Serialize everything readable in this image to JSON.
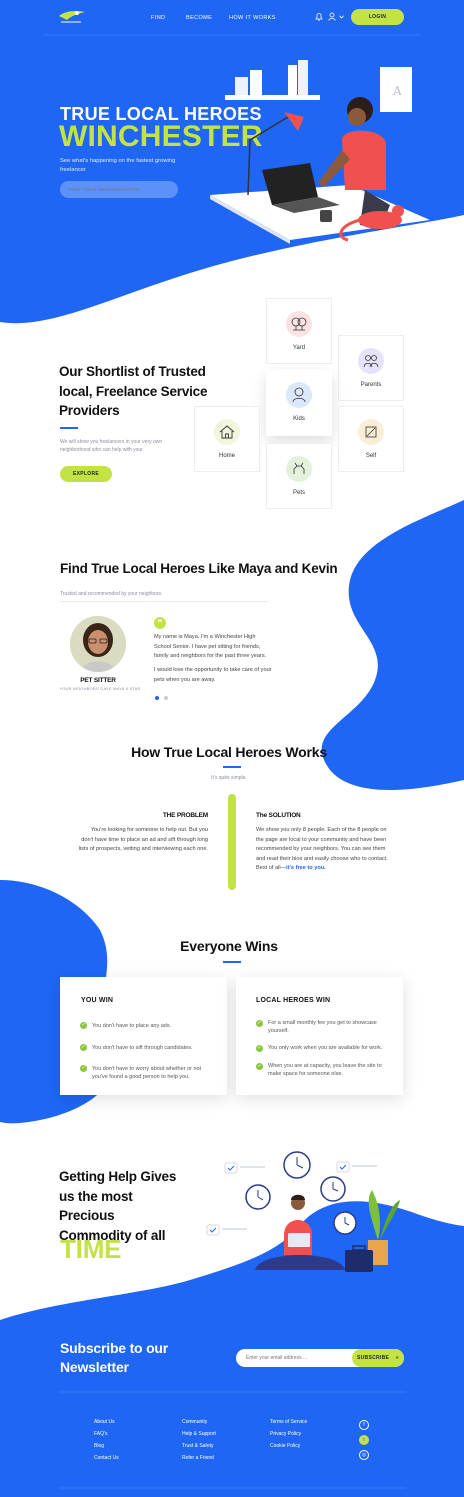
{
  "header": {
    "nav": [
      "FIND",
      "BECOME",
      "HOW IT WORKS"
    ],
    "login_label": "LOGIN",
    "icons": [
      "bell-icon",
      "user-icon",
      "chevron-down-icon"
    ]
  },
  "hero": {
    "title_line1": "TRUE LOCAL HEROES",
    "title_line2": "WINCHESTER",
    "subtitle": "See what's happening on the fastest growing freelancer",
    "search_placeholder": "FIND YOUR NEIGHBORHOOD"
  },
  "shortlist": {
    "heading": "Our Shortlist of Trusted local, Freelance Service Providers",
    "description": "We will show you freelancers in your very own neighborhood who can help with your",
    "button_label": "EXPLORE",
    "categories": [
      {
        "label": "Yard",
        "icon": "tree-icon"
      },
      {
        "label": "Parents",
        "icon": "parents-icon"
      },
      {
        "label": "Kids",
        "icon": "kids-icon"
      },
      {
        "label": "Home",
        "icon": "home-icon"
      },
      {
        "label": "Self",
        "icon": "self-icon"
      },
      {
        "label": "Pets",
        "icon": "dog-icon"
      }
    ]
  },
  "heroes": {
    "heading": "Find True Local Heroes Like Maya and Kevin",
    "subheading": "Trusted and recommended by your neighbors.",
    "profile_role": "PET SITTER",
    "profile_caption": "YOUR NEIGHBORS GAVE MAYA 5 STAR",
    "quote_p1": "My name is Maya. I'm a Winchester High School Senior. I have pet sitting for friends, family and neighbors for the past three years.",
    "quote_p2": "I would love the opportunity to take care of your pets when you are away.",
    "quote_mark": "“"
  },
  "how": {
    "heading": "How True Local Heroes Works",
    "subheading": "It's quite simple.",
    "problem_title": "THE PROBLEM",
    "problem_text": "You're looking for someone to help out. But you don't have time to place an ad and sift through long lists of prospects, vetting and interviewing each one.",
    "solution_title": "The SOLUTION",
    "solution_text": "We show you only 8 people. Each of the 8 people on the page are local to your community and have been recommended by your neighbors. You can see them and read their bios and easily choose who to contact. Best of all—",
    "solution_highlight": "it's free to you."
  },
  "wins": {
    "heading": "Everyone Wins",
    "you_title": "YOU WIN",
    "you_items": [
      "You don't have to place any ads.",
      "You don't have to sift through candidates.",
      "You don't have to worry about whether or not you've found a good person to help you."
    ],
    "heroes_title": "LOCAL HEROES WIN",
    "heroes_items": [
      "For a small monthly fee you get to showcase yourself.",
      "You only work when you are available for work.",
      "When you are at capacity, you leave the site to make space for someone else."
    ]
  },
  "time": {
    "heading": "Getting Help Gives us the most Precious Commodity of all",
    "highlight": "TIME"
  },
  "newsletter": {
    "heading": "Subscribe to our Newsletter",
    "input_placeholder": "Enter your email address ...",
    "button_label": "SUBSCRIBE",
    "button_arrow": "»"
  },
  "footer": {
    "col1": [
      "About Us",
      "FAQ's",
      "Blog",
      "Contact Us"
    ],
    "col2": [
      "Community",
      "Help & Support",
      "Trust & Safety",
      "Refer a Friend"
    ],
    "col3": [
      "Terms of Service",
      "Privacy Policy",
      "Cookie Policy"
    ],
    "social": [
      {
        "icon": "facebook-icon",
        "glyph": "f"
      },
      {
        "icon": "twitter-icon",
        "glyph": "t"
      },
      {
        "icon": "instagram-icon",
        "glyph": "◎"
      }
    ]
  },
  "colors": {
    "brand_blue": "#1f66f5",
    "accent_green": "#c3e345",
    "check_green": "#8cc63f"
  }
}
